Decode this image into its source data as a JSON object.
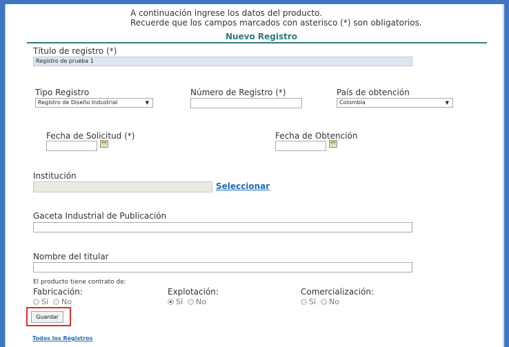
{
  "intro": {
    "line1": "A continuación ingrese los datos del producto.",
    "line2": "Recuerde que los campos marcados con asterisco (*) son obligatorios."
  },
  "section_title": "Nuevo Registro",
  "colors": {
    "frame": "#3f76c0",
    "section_title": "#2c7a7b",
    "highlight": "#e22b2b",
    "link": "#1e6bb8"
  },
  "form": {
    "titulo": {
      "label": "Título de registro (*)",
      "value": "Registro de prueba 1"
    },
    "tipo": {
      "label": "Tipo Registro",
      "selected": "Registro de Diseño Industrial"
    },
    "numero": {
      "label": "Número de Registro (*)",
      "value": ""
    },
    "pais": {
      "label": "País de obtención",
      "selected": "Colombia"
    },
    "fecha_solicitud": {
      "label": "Fecha de Solicitud (*)",
      "value": "",
      "icon": "calendar-icon"
    },
    "fecha_obtencion": {
      "label": "Fecha de Obtención",
      "value": "",
      "icon": "calendar-icon"
    },
    "institucion": {
      "label": "Institución",
      "value": "",
      "link": "Seleccionar"
    },
    "gaceta": {
      "label": "Gaceta Industrial de Publicación",
      "value": ""
    },
    "titular": {
      "label": "Nombre del titular",
      "value": ""
    },
    "contrato": {
      "label": "El producto tiene contrato de:",
      "groups": [
        {
          "label": "Fabricación:",
          "yes": "Sí",
          "no": "No",
          "selected": "none"
        },
        {
          "label": "Explotación:",
          "yes": "Sí",
          "no": "No",
          "selected": "yes"
        },
        {
          "label": "Comercialización:",
          "yes": "Sí",
          "no": "No",
          "selected": "none"
        }
      ]
    }
  },
  "actions": {
    "save_label": "Guardar",
    "all_records_link": "Todos los Registros"
  }
}
